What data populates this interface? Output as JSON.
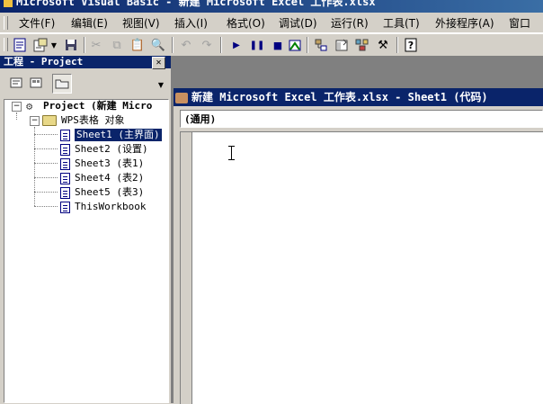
{
  "window": {
    "title": "Microsoft Visual Basic - 新建 Microsoft Excel 工作表.xlsx"
  },
  "menubar": {
    "items": [
      "文件(F)",
      "编辑(E)",
      "视图(V)",
      "插入(I)",
      "格式(O)",
      "调试(D)",
      "运行(R)",
      "工具(T)",
      "外接程序(A)",
      "窗口"
    ]
  },
  "project_panel": {
    "title": "工程 - Project",
    "tree": {
      "project": "Project (新建 Micro",
      "folder": "WPS表格 对象",
      "items": [
        "Sheet1 (主界面)",
        "Sheet2 (设置)",
        "Sheet3 (表1)",
        "Sheet4 (表2)",
        "Sheet5 (表3)",
        "ThisWorkbook"
      ],
      "selected_index": 0
    }
  },
  "code_window": {
    "title": "新建 Microsoft Excel 工作表.xlsx - Sheet1 (代码)",
    "object_combo_value": "(通用)"
  },
  "icons": {
    "toolbar": [
      "view-excel-icon",
      "insert-module-icon",
      "dropdown-arrow-icon",
      "save-icon",
      "cut-icon",
      "copy-icon",
      "paste-icon",
      "find-icon",
      "undo-icon",
      "redo-icon",
      "run-icon",
      "break-icon",
      "reset-icon",
      "design-mode-icon",
      "project-explorer-icon",
      "properties-icon",
      "object-browser-icon",
      "toolbox-icon",
      "help-icon"
    ]
  },
  "colors": {
    "title_active": "#0a246a",
    "chrome": "#d4d0c8",
    "mdi_background": "#808080"
  }
}
